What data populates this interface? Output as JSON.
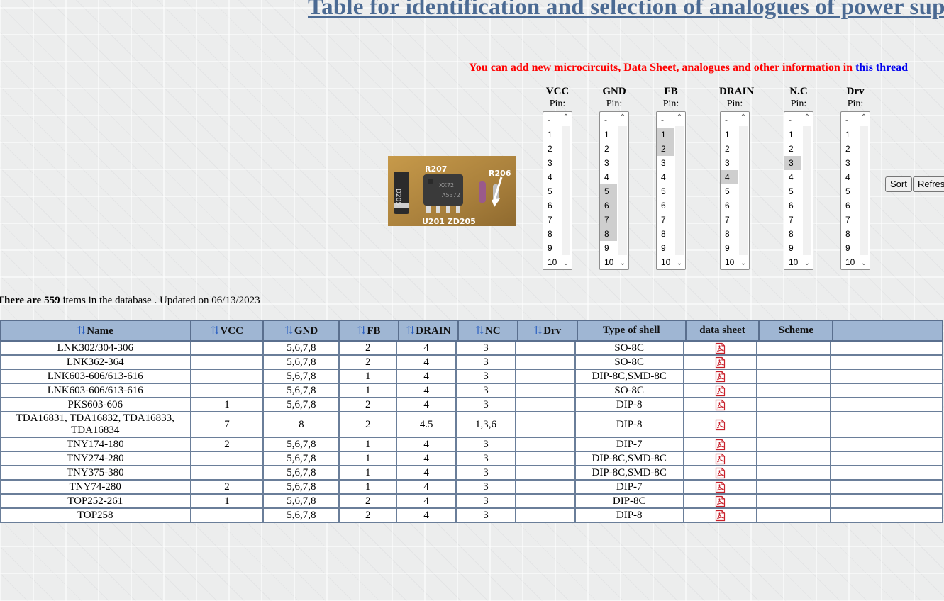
{
  "page": {
    "title": "Table for identification and selection of analogues of power sup",
    "notice_text": "You can add new microcircuits, Data Sheet, analogues and other information in ",
    "notice_link": "this thread"
  },
  "pin_filters": {
    "sub_label": "Pin:",
    "options": [
      "-",
      "1",
      "2",
      "3",
      "4",
      "5",
      "6",
      "7",
      "8",
      "9",
      "10"
    ],
    "columns": [
      {
        "name": "VCC",
        "selected": []
      },
      {
        "name": "GND",
        "selected": [
          "5",
          "6",
          "7",
          "8"
        ]
      },
      {
        "name": "FB",
        "selected": [
          "1",
          "2"
        ]
      },
      {
        "name": "DRAIN",
        "selected": [
          "4"
        ]
      },
      {
        "name": "N.C",
        "selected": [
          "3"
        ]
      },
      {
        "name": "Drv",
        "selected": []
      }
    ]
  },
  "buttons": {
    "sort": "Sort",
    "refresh": "Refres"
  },
  "db_info": {
    "prefix": "There are ",
    "count": "559",
    "suffix": " items in the database . Updated on 06/13/2023"
  },
  "table": {
    "sort_arrows": "⇅",
    "headers": [
      "Name",
      "VCC",
      "GND",
      "FB",
      "DRAIN",
      "NC",
      "Drv",
      "Type of shell",
      "data sheet",
      "Scheme",
      ""
    ],
    "sortable": [
      true,
      true,
      true,
      true,
      true,
      true,
      true,
      false,
      false,
      false,
      false
    ],
    "rows": [
      [
        "LNK302/304-306",
        "",
        "5,6,7,8",
        "2",
        "4",
        "3",
        "",
        "SO-8C"
      ],
      [
        "LNK362-364",
        "",
        "5,6,7,8",
        "2",
        "4",
        "3",
        "",
        "SO-8C"
      ],
      [
        "LNK603-606/613-616",
        "",
        "5,6,7,8",
        "1",
        "4",
        "3",
        "",
        "DIP-8C,SMD-8C"
      ],
      [
        "LNK603-606/613-616",
        "",
        "5,6,7,8",
        "1",
        "4",
        "3",
        "",
        "SO-8C"
      ],
      [
        "PKS603-606",
        "1",
        "5,6,7,8",
        "2",
        "4",
        "3",
        "",
        "DIP-8"
      ],
      [
        "TDA16831, TDA16832, TDA16833, TDA16834",
        "7",
        "8",
        "2",
        "4.5",
        "1,3,6",
        "",
        "DIP-8"
      ],
      [
        "TNY174-180",
        "2",
        "5,6,7,8",
        "1",
        "4",
        "3",
        "",
        "DIP-7"
      ],
      [
        "TNY274-280",
        "",
        "5,6,7,8",
        "1",
        "4",
        "3",
        "",
        "DIP-8C,SMD-8C"
      ],
      [
        "TNY375-380",
        "",
        "5,6,7,8",
        "1",
        "4",
        "3",
        "",
        "DIP-8C,SMD-8C"
      ],
      [
        "TNY74-280",
        "2",
        "5,6,7,8",
        "1",
        "4",
        "3",
        "",
        "DIP-7"
      ],
      [
        "TOP252-261",
        "1",
        "5,6,7,8",
        "2",
        "4",
        "3",
        "",
        "DIP-8C"
      ],
      [
        "TOP258",
        "",
        "5,6,7,8",
        "2",
        "4",
        "3",
        "",
        "DIP-8"
      ]
    ]
  },
  "colors": {
    "title": "#4b6a93",
    "notice": "#ff0000",
    "link": "#0000ee",
    "header_bg": "#9fb6d3",
    "border": "#5a6f8e",
    "sort_arrow": "#2a5fc2",
    "pdf": "#c8202a"
  },
  "icons": {
    "pdf": "pdf-file-icon"
  }
}
